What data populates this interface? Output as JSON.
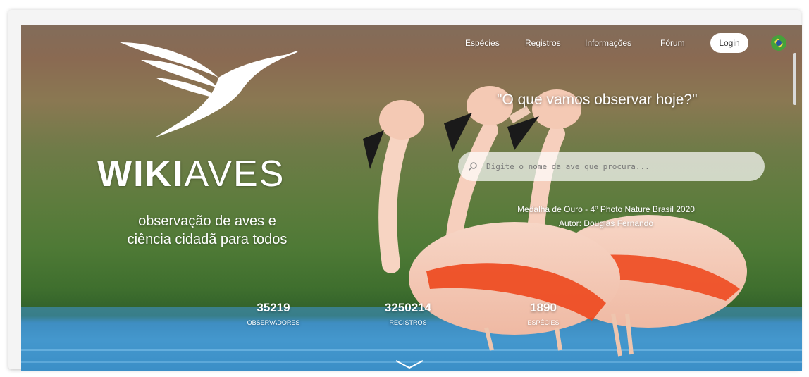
{
  "nav": {
    "items": [
      "Espécies",
      "Registros",
      "Informações",
      "Fórum"
    ],
    "login_label": "Login",
    "language_icon": "brazil-flag-icon"
  },
  "brand": {
    "name_bold": "WIKI",
    "name_light": "AVES",
    "logo_icon": "hummingbird-logo-icon",
    "tagline_line1": "observação de aves e",
    "tagline_line2": "ciência cidadã para todos"
  },
  "hero": {
    "question": "\"O que vamos observar hoje?\"",
    "photo_credit_line1": "Medalha de Ouro - 4º Photo Nature Brasil 2020",
    "photo_credit_line2": "Autor: Douglas Fernando"
  },
  "search": {
    "placeholder": "Digite o nome da ave que procura...",
    "value": "",
    "icon": "search-icon"
  },
  "stats": [
    {
      "value": "35219",
      "label": "OBSERVADORES"
    },
    {
      "value": "3250214",
      "label": "REGISTROS"
    },
    {
      "value": "1890",
      "label": "ESPÉCIES"
    }
  ],
  "scroll_hint_icon": "chevron-down-icon",
  "colors": {
    "flamingo_pink": "#f4c9b4",
    "flamingo_orange": "#ee4a20",
    "water_blue": "#4c9fd2",
    "background_green": "#5f7c3e"
  }
}
